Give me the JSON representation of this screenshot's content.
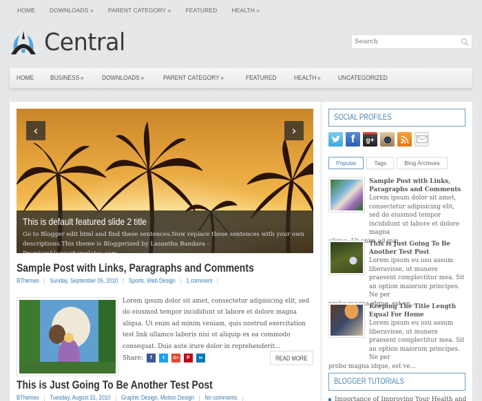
{
  "top_nav": [
    {
      "label": "HOME"
    },
    {
      "label": "DOWNLOADS »"
    },
    {
      "label": "PARENT CATEGORY »"
    },
    {
      "label": "FEATURED"
    },
    {
      "label": "HEALTH »"
    }
  ],
  "logo": {
    "text": "Central"
  },
  "search": {
    "placeholder": "Search"
  },
  "main_nav": [
    {
      "label": "HOME",
      "arrow": ""
    },
    {
      "label": "BUSINESS",
      "arrow": "»"
    },
    {
      "label": "DOWNLOADS",
      "arrow": "»"
    },
    {
      "label": "PARENT CATEGORY",
      "arrow": "»"
    },
    {
      "label": "FEATURED",
      "arrow": ""
    },
    {
      "label": "HEALTH",
      "arrow": "»"
    },
    {
      "label": "UNCATEGORIZED",
      "arrow": ""
    }
  ],
  "slider": {
    "prev": "‹",
    "next": "›",
    "title": "This is default featured slide 2 title",
    "description": "Go to Blogger edit html and find these sentences.Now replace these sentences with your own descriptions.This theme is Bloggerized by Lasantha Bandara - Premiumbloggertemplates.com."
  },
  "posts": [
    {
      "title": "Sample Post with Links, Paragraphs and Comments",
      "author": "BThemes",
      "date": "Sunday, September 05, 2010",
      "labels": "Sports, Web Design",
      "comments": "1 comment",
      "excerpt": "Lorem ipsum dolor sit amet, consectetur adipisicing elit, sed do eiusmod tempor incididunt ut labore et dolore magna aliqua. Ut enim ad minim veniam, quis nostrud exercitation test link ullamco laboris nisi ut aliquip ex ea commodo consequat. Duis aute irure dolor in reprehenderit...",
      "share_label": "Share:",
      "read_more": "READ MORE"
    },
    {
      "title": "This is Just Going To Be Another Test Post",
      "author": "BThemes",
      "date": "Tuesday, August 31, 2010",
      "labels": "Graphic Design, Motion Design",
      "comments": "No comments"
    }
  ],
  "share_buttons": [
    {
      "name": "facebook",
      "glyph": "f",
      "color": "#3b5998"
    },
    {
      "name": "twitter",
      "glyph": "t",
      "color": "#1da1f2"
    },
    {
      "name": "google-plus",
      "glyph": "G+",
      "color": "#dd4b39"
    },
    {
      "name": "pinterest",
      "glyph": "P",
      "color": "#bd081c"
    },
    {
      "name": "linkedin",
      "glyph": "in",
      "color": "#0077b5"
    }
  ],
  "sidebar": {
    "social_title": "SOCIAL PROFILES",
    "social_icons": [
      {
        "name": "twitter",
        "color": "#4fb7e8"
      },
      {
        "name": "facebook",
        "color": "#3d6bb8"
      },
      {
        "name": "google-plus",
        "color": "#333333"
      },
      {
        "name": "instagram",
        "color": "#c9a27a"
      },
      {
        "name": "rss",
        "color": "#f28c1e"
      },
      {
        "name": "email",
        "color": "#eeeeee"
      }
    ],
    "tabs": [
      {
        "label": "Popular",
        "active": true
      },
      {
        "label": "Tags",
        "active": false
      },
      {
        "label": "Blog Archives",
        "active": false
      }
    ],
    "popular_posts": [
      {
        "title": "Sample Post with Links, Paragraphs and Comments",
        "text_indent": "Lorem ipsum dolor sit amet, consectetur adipisicing elit, sed do eiusmod tempor incididunt ut labore et dolore magna",
        "text_rest": "aliqua. Ut enim ad min..."
      },
      {
        "title": "This is Just Going To Be Another Test Post",
        "text_indent": "Lorem ipsum eu usu assum liberavisse, ut munere praesent complectitur mea. Sit an option maiorum principes. Ne per",
        "text_rest": "probo magna idque, est ve..."
      },
      {
        "title": "Keeping The Title Length Equal For Home",
        "text_indent": "Lorem ipsum eu usu assum liberavisse, ut munere praesent complectitur mea. Sit an option maiorum principes. Ne per",
        "text_rest": "probo magna idque, est ve..."
      }
    ],
    "tutorials_title": "BLOGGER TUTORIALS",
    "tutorials": [
      {
        "label": "Importance of Improving Your Health and"
      }
    ]
  },
  "colors": {
    "accent": "#3a7bb5",
    "widget_border": "#6b9bbf"
  }
}
